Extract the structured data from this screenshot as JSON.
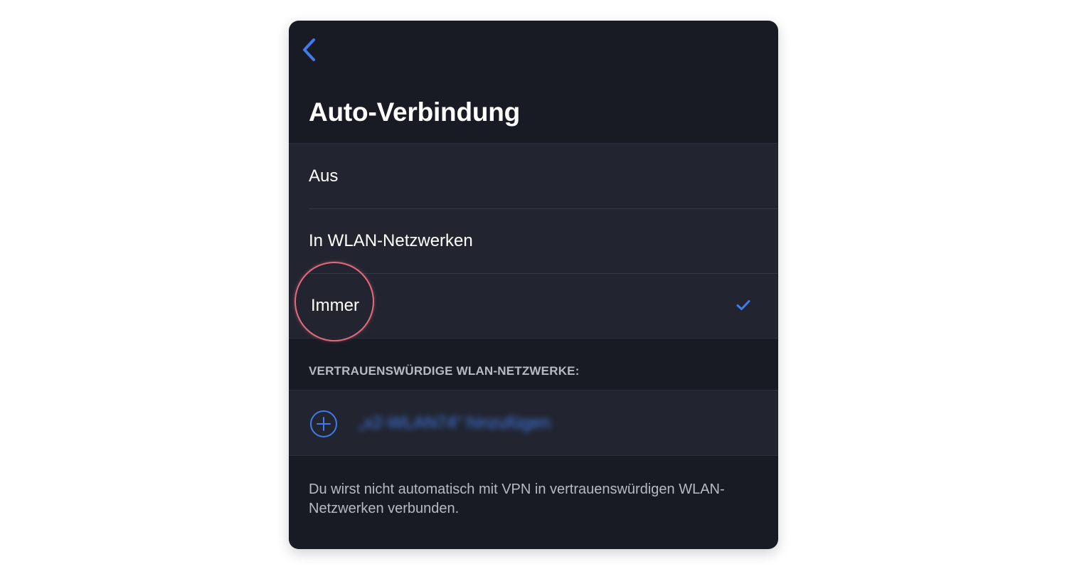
{
  "screen": {
    "title": "Auto-Verbindung",
    "back_icon": "chevron-left-icon"
  },
  "options": [
    {
      "label": "Aus",
      "selected": false
    },
    {
      "label": "In WLAN-Netzwerken",
      "selected": false
    },
    {
      "label": "Immer",
      "selected": true
    }
  ],
  "trusted_networks": {
    "header": "VERTRAUENSWÜRDIGE WLAN-NETZWERKE:",
    "add_label": "„x2-WLAN74“ hinzufügen",
    "add_icon": "plus-circle-icon"
  },
  "footer": {
    "note": "Du wirst nicht automatisch mit VPN in vertrauenswürdigen WLAN-Netzwerken verbunden."
  },
  "colors": {
    "accent": "#3f7bea",
    "background": "#191b24",
    "row_background": "#222530",
    "highlight": "#e46a7c"
  }
}
